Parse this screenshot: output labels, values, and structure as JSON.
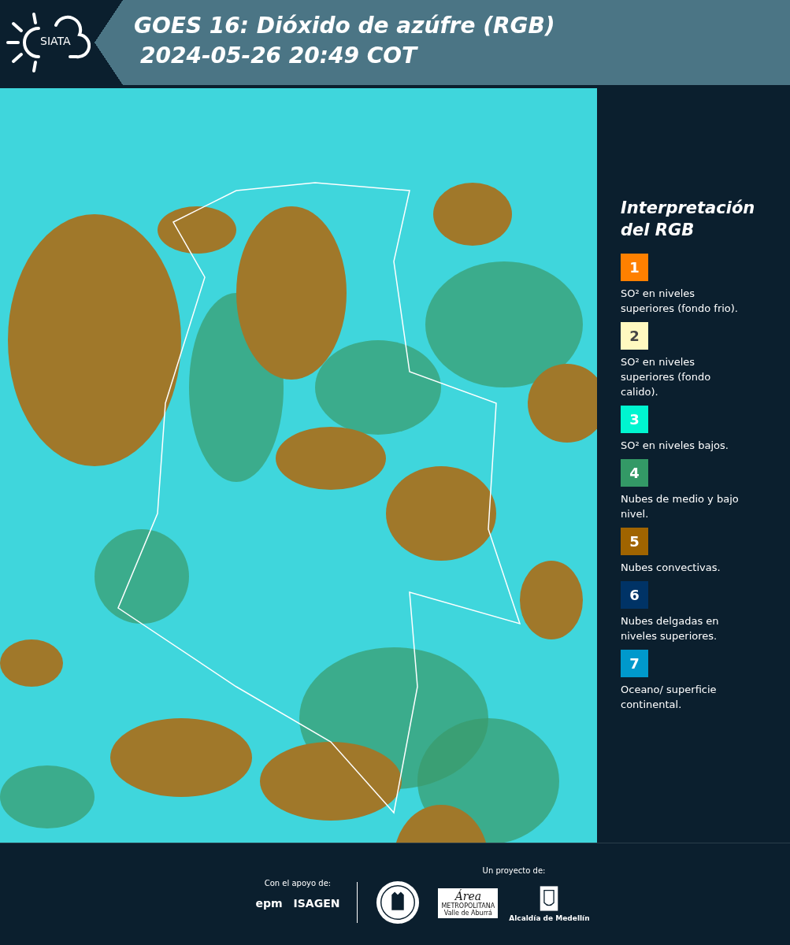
{
  "header": {
    "logo_text": "SIATA",
    "title": "GOES 16: Dióxido de azúfre (RGB)",
    "timestamp": "2024-05-26 20:49 COT"
  },
  "legend": {
    "title": "Interpretación del RGB",
    "items": [
      {
        "number": "1",
        "color": "#ff8000",
        "text": "SO² en niveles superiores (fondo frio)."
      },
      {
        "number": "2",
        "color": "#fff9c0",
        "text": "SO² en niveles superiores (fondo calido)."
      },
      {
        "number": "3",
        "color": "#00f5d0",
        "text": "SO² en niveles bajos."
      },
      {
        "number": "4",
        "color": "#339966",
        "text": "Nubes de medio y bajo nivel."
      },
      {
        "number": "5",
        "color": "#a06400",
        "text": "Nubes convectivas."
      },
      {
        "number": "6",
        "color": "#003366",
        "text": "Nubes delgadas en niveles superiores."
      },
      {
        "number": "7",
        "color": "#0099cc",
        "text": "Oceano/ superficie continental."
      }
    ]
  },
  "footer": {
    "support_label": "Con el apoyo de:",
    "support_logos": [
      "epm",
      "ISAGEN"
    ],
    "project_label": "Un proyecto de:",
    "area_logo": {
      "title": "Área",
      "line_1": "METROPOLITANA",
      "line_2": "Valle de Aburrá"
    },
    "alcaldia_label": "Alcaldía de Medellín"
  }
}
